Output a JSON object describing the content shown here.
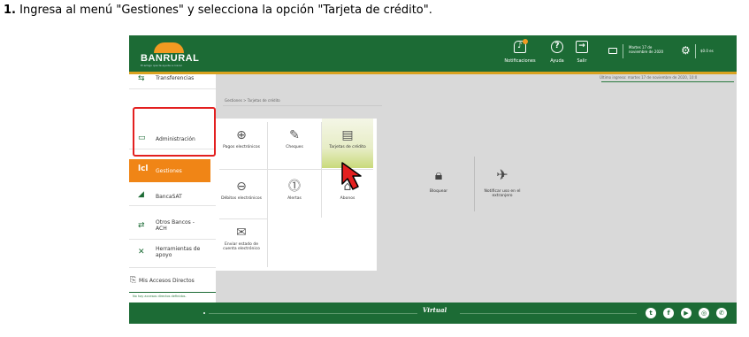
{
  "instruction": {
    "number": "1.",
    "text": " Ingresa al menú \"Gestiones\" y selecciona la opción \"Tarjeta de crédito\"."
  },
  "header": {
    "logo_text": "BANRURAL",
    "logo_tagline": "El amigo que te ayuda a crecer",
    "notifications_label": "Notificaciones",
    "help_label": "Ayuda",
    "exit_label": "Salir",
    "last_login": "Martes 17 de noviembre de 2020",
    "balance": "$0.0 es"
  },
  "welcome": "Último ingreso: martes 17 de noviembre de 2020, 10:0",
  "breadcrumb": "Gestiones > Tarjetas de crédito",
  "sidebar": {
    "items": [
      {
        "label": "Transferencias",
        "icon": "transfer-icon"
      },
      {
        "label": "Administración",
        "icon": "admin-icon"
      },
      {
        "label": "Gestiones",
        "icon": "gestiones-icon"
      },
      {
        "label": "BancaSAT",
        "icon": "bancasat-icon"
      },
      {
        "label": "Otros Bancos - ACH",
        "icon": "ach-icon"
      },
      {
        "label": "Herramientas de apoyo",
        "icon": "tools-icon"
      },
      {
        "label": "Mis Accesos Directos",
        "icon": "shortcuts-icon"
      }
    ],
    "no_shortcuts": "No hay accesos directos definidos."
  },
  "submenu": [
    {
      "label": "Pagos electrónicos",
      "icon": "payments-icon"
    },
    {
      "label": "Cheques",
      "icon": "cheque-icon"
    },
    {
      "label": "Tarjetas de crédito",
      "icon": "credit-card-icon"
    },
    {
      "label": "Débitos electrónicos",
      "icon": "debits-icon"
    },
    {
      "label": "Alertas",
      "icon": "alert-icon"
    },
    {
      "label": "Abonos",
      "icon": "deposit-icon"
    },
    {
      "label": "Enviar estado de cuenta electrónico",
      "icon": "mail-statement-icon"
    }
  ],
  "cards": [
    {
      "label": "Bloquear",
      "icon": "lock-icon"
    },
    {
      "label": "Notificar uso en el extranjero",
      "icon": "airplane-icon"
    }
  ],
  "footer": {
    "brand": "Virtual",
    "social": [
      "twitter-icon",
      "facebook-icon",
      "youtube-icon",
      "instagram-icon",
      "whatsapp-icon"
    ]
  },
  "colors": {
    "brand_green": "#1c6b35",
    "brand_orange": "#f08516",
    "highlight_red": "#e32020"
  }
}
